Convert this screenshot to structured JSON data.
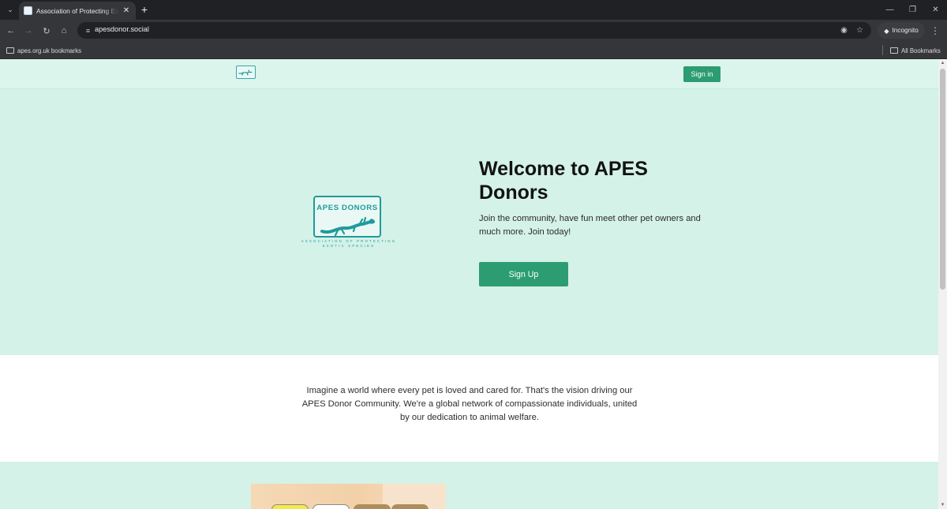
{
  "browser": {
    "tab_title": "Association of Protecting Exotic Species",
    "url": "apesdonor.social",
    "incognito_label": "Incognito",
    "bookmarks": {
      "folder_label": "apes.org.uk bookmarks",
      "all_label": "All Bookmarks"
    }
  },
  "header": {
    "sign_in_label": "Sign in"
  },
  "hero": {
    "logo": {
      "title": "APES DONORS",
      "subtitle": "ASSOCIATION OF PROTECTING EXOTIC SPECIES"
    },
    "title": "Welcome to APES Donors",
    "description": "Join the community, have fun meet other pet owners and much more. Join today!",
    "sign_up_label": "Sign Up"
  },
  "vision": {
    "text": "Imagine a world where every pet is loved and cared for. That's the vision driving our APES Donor Community. We're a global network of compassionate individuals, united by our dedication to animal welfare."
  },
  "colors": {
    "accent": "#2c9c73",
    "hero_bg": "#d4f2e7",
    "logo_teal": "#1f9a9c"
  }
}
